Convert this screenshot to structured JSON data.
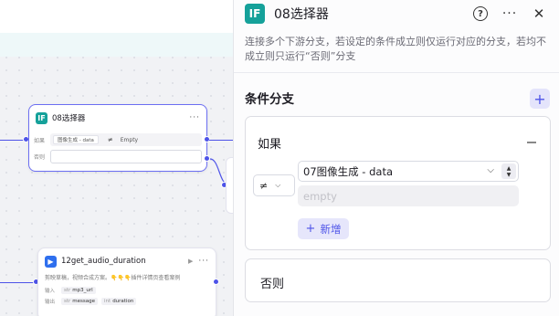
{
  "canvas": {
    "selector_node": {
      "icon": "IF",
      "title": "08选择器",
      "more": "···",
      "if_label": "如果",
      "cond_left": "图像生成 - data",
      "cond_op": "≠",
      "cond_right": "Empty",
      "else_label": "否则"
    },
    "audio_node": {
      "title": "12get_audio_duration",
      "desc": "剪映草稿，视频合成方案。👇👇👇插件详情页查看案例",
      "input_label": "输入",
      "input_type": "str",
      "input_name": "mp3_url",
      "output_label": "输出",
      "output1_type": "str",
      "output1_name": "message",
      "output2_type": "int",
      "output2_name": "duration"
    }
  },
  "panel": {
    "icon": "IF",
    "title": "08选择器",
    "help_icon": "?",
    "more_icon": "···",
    "close_icon": "✕",
    "description": "连接多个下游分支，若设定的条件成立则仅运行对应的分支，若均不成立则只运行“否则”分支",
    "section_title": "条件分支",
    "add_icon": "+",
    "branch": {
      "label": "如果",
      "operator": "≠",
      "left_value": "07图像生成 - data",
      "right_placeholder": "empty",
      "new_label": "新增",
      "new_icon": "+"
    },
    "else_label": "否则"
  },
  "colors": {
    "accent": "#4d53e8",
    "node_icon_teal": "#15a19a",
    "plugin_icon_blue": "#2e6fee"
  }
}
